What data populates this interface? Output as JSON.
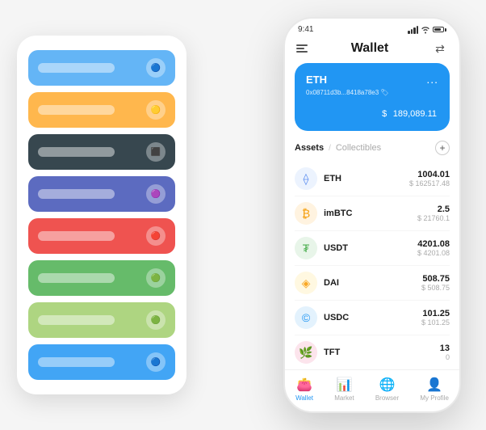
{
  "app": {
    "title": "Wallet"
  },
  "phone": {
    "status": {
      "time": "9:41",
      "signal": "●●●",
      "wifi": "wifi",
      "battery": "battery"
    },
    "header": {
      "menu_label": "menu",
      "title": "Wallet",
      "expand_label": "expand"
    },
    "eth_card": {
      "symbol": "ETH",
      "address": "0x08711d3b...8418a78e3",
      "tag": "🏷",
      "balance_currency": "$",
      "balance": "189,089.11",
      "dots": "..."
    },
    "assets_section": {
      "tab_active": "Assets",
      "separator": "/",
      "tab_inactive": "Collectibles",
      "add_label": "+"
    },
    "assets": [
      {
        "symbol": "ETH",
        "icon": "⟠",
        "icon_class": "eth-icon",
        "amount": "1004.01",
        "usd": "$ 162517.48"
      },
      {
        "symbol": "imBTC",
        "icon": "🔵",
        "icon_class": "imbtc-icon",
        "amount": "2.5",
        "usd": "$ 21760.1"
      },
      {
        "symbol": "USDT",
        "icon": "₮",
        "icon_class": "usdt-icon",
        "amount": "4201.08",
        "usd": "$ 4201.08"
      },
      {
        "symbol": "DAI",
        "icon": "◈",
        "icon_class": "dai-icon",
        "amount": "508.75",
        "usd": "$ 508.75"
      },
      {
        "symbol": "USDC",
        "icon": "$",
        "icon_class": "usdc-icon",
        "amount": "101.25",
        "usd": "$ 101.25"
      },
      {
        "symbol": "TFT",
        "icon": "🌿",
        "icon_class": "tft-icon",
        "amount": "13",
        "usd": "0"
      }
    ],
    "nav": [
      {
        "label": "Wallet",
        "icon": "👛",
        "active": true
      },
      {
        "label": "Market",
        "icon": "📊",
        "active": false
      },
      {
        "label": "Browser",
        "icon": "🌐",
        "active": false
      },
      {
        "label": "My Profile",
        "icon": "👤",
        "active": false
      }
    ]
  },
  "card_stack": {
    "cards": [
      {
        "color": "#64b5f6",
        "label": ""
      },
      {
        "color": "#ffb74d",
        "label": ""
      },
      {
        "color": "#37474f",
        "label": ""
      },
      {
        "color": "#5c6bc0",
        "label": ""
      },
      {
        "color": "#ef5350",
        "label": ""
      },
      {
        "color": "#66bb6a",
        "label": ""
      },
      {
        "color": "#aed581",
        "label": ""
      },
      {
        "color": "#42a5f5",
        "label": ""
      }
    ]
  }
}
